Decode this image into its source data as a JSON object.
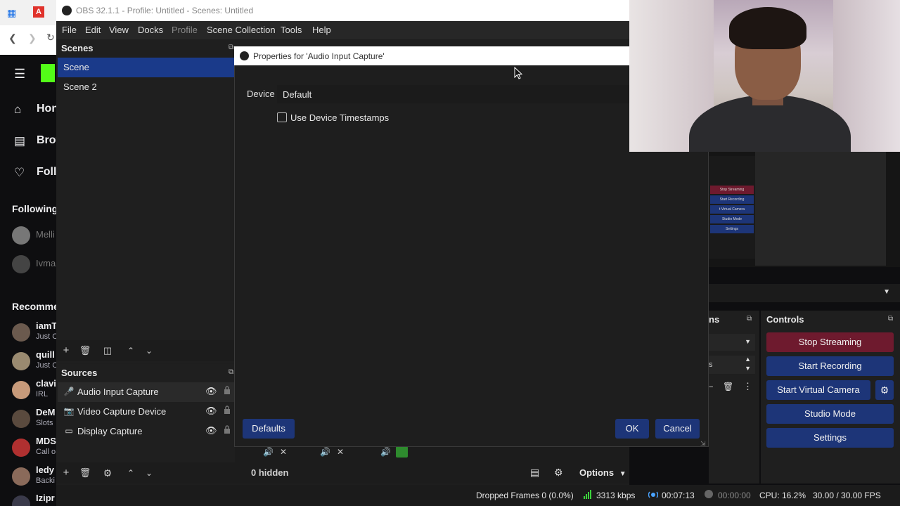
{
  "obs": {
    "title": "OBS 32.1.1 - Profile: Untitled - Scenes: Untitled",
    "menu": [
      "File",
      "Edit",
      "View",
      "Docks",
      "Profile",
      "Scene Collection",
      "Tools",
      "Help"
    ]
  },
  "scenes": {
    "header": "Scenes",
    "items": [
      "Scene",
      "Scene 2"
    ]
  },
  "sources": {
    "header": "Sources",
    "items": [
      {
        "label": "Audio Input Capture",
        "icon": "microphone-icon"
      },
      {
        "label": "Video Capture Device",
        "icon": "camera-icon"
      },
      {
        "label": "Display Capture",
        "icon": "monitor-icon"
      }
    ]
  },
  "mixer": {
    "hidden_label": "0 hidden",
    "options_label": "Options"
  },
  "properties": {
    "title": "Properties for 'Audio Input Capture'",
    "device_label": "Device",
    "device_value": "Default",
    "timestamps_label": "Use Device Timestamps",
    "timestamps_checked": false,
    "defaults_label": "Defaults",
    "ok_label": "OK",
    "cancel_label": "Cancel"
  },
  "controls": {
    "header": "Controls",
    "transitions_header_fragment": "ns",
    "stop_streaming": "Stop Streaming",
    "start_recording": "Start Recording",
    "start_virtual_camera": "Start Virtual Camera",
    "studio_mode": "Studio Mode",
    "settings": "Settings",
    "duration_fragment": "s"
  },
  "status": {
    "dropped_frames": "Dropped Frames 0 (0.0%)",
    "bitrate": "3313 kbps",
    "stream_time": "00:07:13",
    "record_time": "00:00:00",
    "cpu": "CPU: 16.2%",
    "fps": "30.00 / 30.00 FPS"
  },
  "browser": {
    "nav": [
      {
        "label": "Hon",
        "icon": "home-icon"
      },
      {
        "label": "Brov",
        "icon": "browse-icon"
      },
      {
        "label": "Follo",
        "icon": "heart-icon"
      }
    ],
    "following_header": "Following",
    "following": [
      "Melli",
      "Ivma"
    ],
    "recommended_header": "Recomme",
    "channels": [
      {
        "name": "iamT",
        "sub": "Just C"
      },
      {
        "name": "quill",
        "sub": "Just C"
      },
      {
        "name": "clavi",
        "sub": "IRL"
      },
      {
        "name": "DeM",
        "sub": "Slots"
      },
      {
        "name": "MDS",
        "sub": "Call o"
      },
      {
        "name": "ledy",
        "sub": "Backi"
      },
      {
        "name": "Izipr",
        "sub": ""
      }
    ]
  },
  "preview_mini": [
    "Stop Streaming",
    "Start Recording",
    "t Virtual Camera",
    "Studio Mode",
    "Settings"
  ],
  "colors": {
    "accent": "#1d3578",
    "streaming": "#6e1a2e",
    "selection": "#1a3a8a"
  }
}
